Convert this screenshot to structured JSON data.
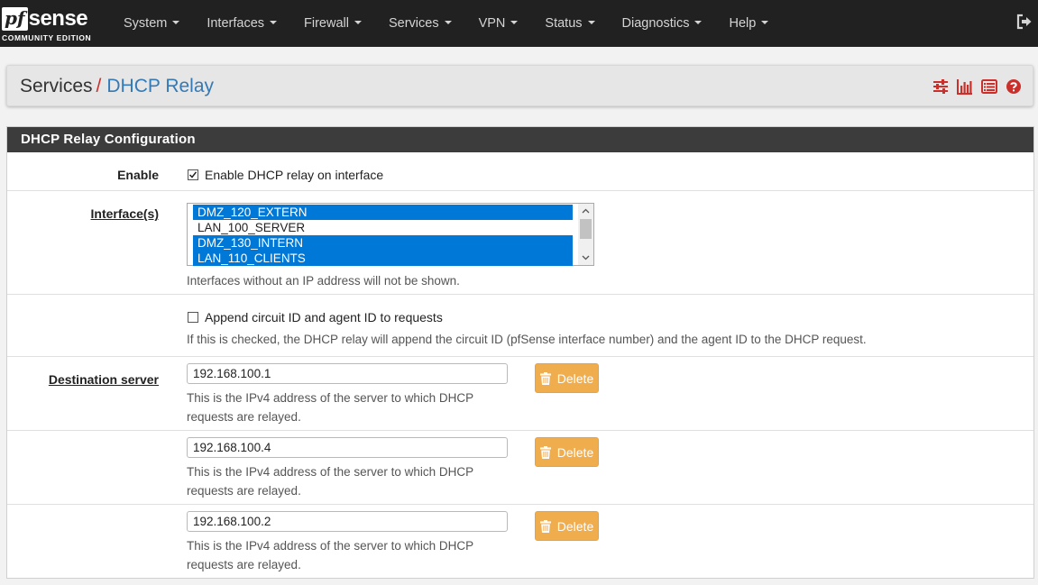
{
  "brand": {
    "logo_pf": "pf",
    "logo_sense": "sense",
    "edition": "COMMUNITY EDITION"
  },
  "nav": {
    "items": [
      {
        "label": "System"
      },
      {
        "label": "Interfaces"
      },
      {
        "label": "Firewall"
      },
      {
        "label": "Services"
      },
      {
        "label": "VPN"
      },
      {
        "label": "Status"
      },
      {
        "label": "Diagnostics"
      },
      {
        "label": "Help"
      }
    ],
    "logout_icon": "sign-out-icon"
  },
  "breadcrumb": {
    "parent": "Services",
    "separator": "/",
    "current": "DHCP Relay",
    "icons": [
      "sliders-icon",
      "bar-chart-icon",
      "log-list-icon",
      "help-circle-icon"
    ]
  },
  "panel": {
    "title": "DHCP Relay Configuration",
    "enable": {
      "label": "Enable",
      "checkbox_text": "Enable DHCP relay on interface",
      "checked": true
    },
    "interfaces": {
      "label": "Interface(s)",
      "options": [
        {
          "name": "DMZ_120_EXTERN",
          "selected": true
        },
        {
          "name": "LAN_100_SERVER",
          "selected": false
        },
        {
          "name": "DMZ_130_INTERN",
          "selected": true
        },
        {
          "name": "LAN_110_CLIENTS",
          "selected": true
        }
      ],
      "help": "Interfaces without an IP address will not be shown."
    },
    "circuit": {
      "checkbox_text": "Append circuit ID and agent ID to requests",
      "checked": false,
      "help": "If this is checked, the DHCP relay will append the circuit ID (pfSense interface number) and the agent ID to the DHCP request."
    },
    "destination": {
      "label": "Destination server",
      "delete_label": "Delete",
      "servers": [
        {
          "value": "192.168.100.1",
          "help_line1": "This is the IPv4 address of the server to which DHCP",
          "help_line2": "requests are relayed."
        },
        {
          "value": "192.168.100.4",
          "help_line1": "This is the IPv4 address of the server to which DHCP",
          "help_line2": "requests are relayed."
        },
        {
          "value": "192.168.100.2",
          "help_line1": "This is the IPv4 address of the server to which DHCP",
          "help_line2": "requests are relayed."
        }
      ]
    }
  },
  "colors": {
    "navbar": "#212121",
    "accent_red": "#c9302c",
    "link_blue": "#337ab7",
    "selected_option": "#0078d7",
    "warning_button": "#f0ad4e"
  }
}
